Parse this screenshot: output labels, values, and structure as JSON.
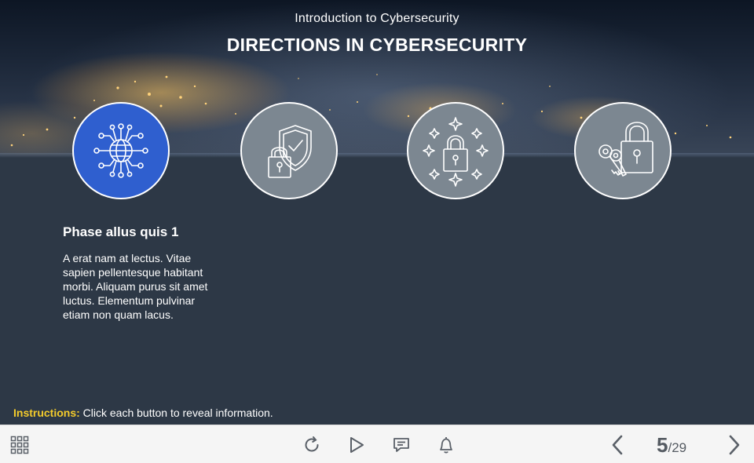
{
  "header": {
    "course_title": "Introduction to Cybersecurity",
    "page_title": "DIRECTIONS IN CYBERSECURITY"
  },
  "buttons": [
    {
      "icon": "network-globe-icon",
      "active": true
    },
    {
      "icon": "padlock-shield-icon",
      "active": false
    },
    {
      "icon": "sparkle-padlock-icon",
      "active": false
    },
    {
      "icon": "padlock-keys-icon",
      "active": false
    }
  ],
  "content": {
    "phase_title": "Phase allus quis 1",
    "phase_body": "A erat nam at lectus. Vitae sapien pellentesque habitant morbi. Aliquam purus sit amet luctus. Elementum pulvinar etiam non quam lacus."
  },
  "instructions": {
    "label": "Instructions:",
    "text": "Click each button to reveal information."
  },
  "toolbar": {
    "menu_icon": "grid-menu-icon",
    "replay_icon": "replay-icon",
    "play_icon": "play-icon",
    "comment_icon": "comment-icon",
    "notification_icon": "bell-icon",
    "prev_icon": "chevron-left-icon",
    "next_icon": "chevron-right-icon",
    "page_current": "5",
    "page_total": "/29"
  },
  "colors": {
    "background": "#2d3846",
    "active_button": "#2f5fcf",
    "inactive_button": "#7c8791",
    "instructions_label": "#f5cc2b",
    "toolbar": "#f5f5f5"
  }
}
